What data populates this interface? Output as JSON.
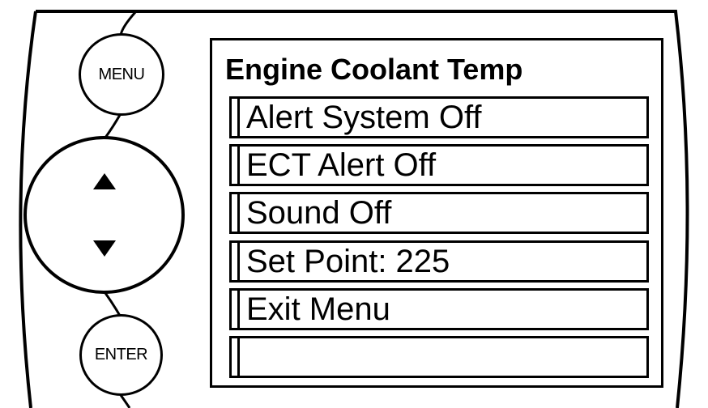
{
  "buttons": {
    "menu_label": "MENU",
    "enter_label": "ENTER"
  },
  "icons": {
    "up": "triangle-up-icon",
    "down": "triangle-down-icon"
  },
  "screen": {
    "title": "Engine Coolant Temp",
    "items": [
      {
        "label": "Alert System Off"
      },
      {
        "label": "ECT Alert Off"
      },
      {
        "label": "Sound Off"
      },
      {
        "label": "Set Point: 225"
      },
      {
        "label": "Exit Menu"
      },
      {
        "label": ""
      }
    ]
  }
}
